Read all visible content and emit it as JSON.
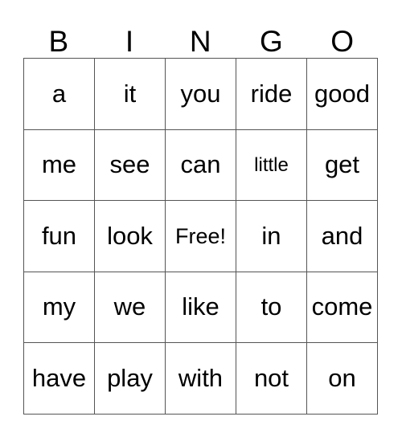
{
  "card": {
    "title": "BINGO",
    "headers": [
      "B",
      "I",
      "N",
      "G",
      "O"
    ],
    "free_space_label": "Free!",
    "colors": {
      "background": "#ffffff",
      "text": "#000000",
      "grid_line": "#555555"
    },
    "rows": [
      {
        "cells": [
          "a",
          "it",
          "you",
          "ride",
          "good"
        ]
      },
      {
        "cells": [
          "me",
          "see",
          "can",
          "little",
          "get"
        ]
      },
      {
        "cells": [
          "fun",
          "look",
          "Free!",
          "in",
          "and"
        ]
      },
      {
        "cells": [
          "my",
          "we",
          "like",
          "to",
          "come"
        ]
      },
      {
        "cells": [
          "have",
          "play",
          "with",
          "not",
          "on"
        ]
      }
    ]
  }
}
